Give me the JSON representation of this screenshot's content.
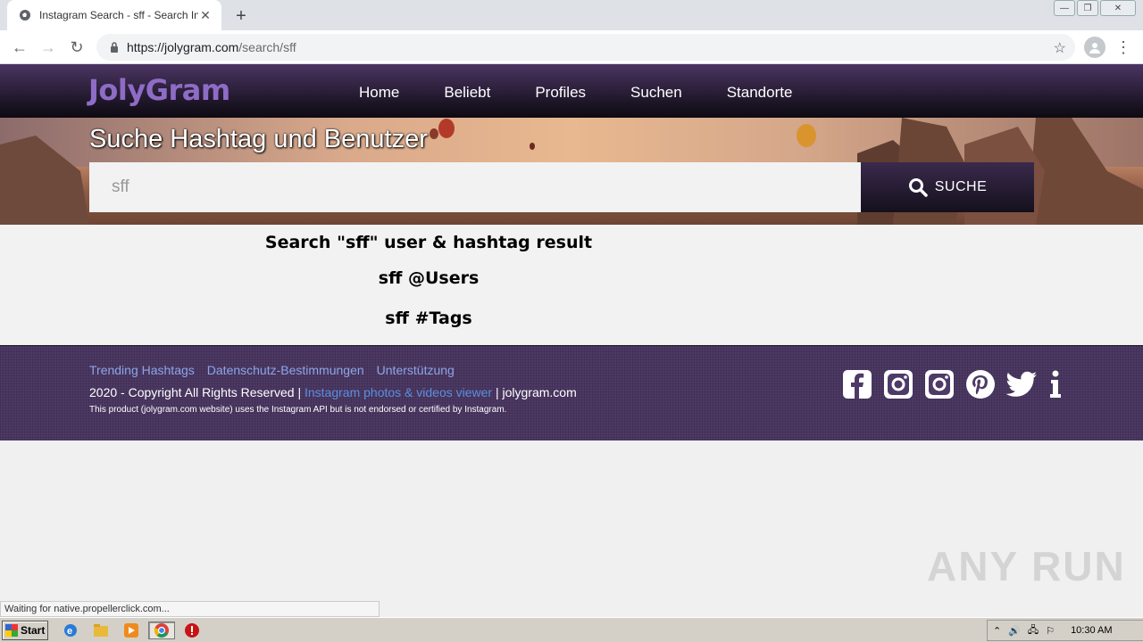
{
  "browser": {
    "tab_title": "Instagram Search - sff - Search In",
    "url_host": "https://jolygram.com",
    "url_path": "/search/sff"
  },
  "site": {
    "logo": "JolyGram",
    "nav": [
      "Home",
      "Beliebt",
      "Profiles",
      "Suchen",
      "Standorte"
    ]
  },
  "hero": {
    "title": "Suche Hashtag und Benutzer",
    "search_value": "sff",
    "search_button": "SUCHE"
  },
  "results": {
    "heading": "Search \"sff\" user & hashtag result",
    "users_heading": "sff @Users",
    "tags_heading": "sff #Tags"
  },
  "footer": {
    "links": [
      "Trending Hashtags",
      "Datenschutz-Bestimmungen",
      "Unterstützung"
    ],
    "copyright_prefix": "2020 - Copyright All Rights Reserved |",
    "copyright_link": "Instagram photos & videos viewer",
    "copyright_suffix": "| jolygram.com",
    "disclaimer": "This product (jolygram.com website) uses the Instagram API but is not endorsed or certified by Instagram.",
    "socials": [
      "facebook-icon",
      "instagram-icon",
      "instagram-icon",
      "pinterest-icon",
      "twitter-icon",
      "info-icon"
    ]
  },
  "status": {
    "text": "Waiting for native.propellerclick.com..."
  },
  "watermark": "ANY RUN",
  "taskbar": {
    "start": "Start",
    "clock": "10:30 AM"
  }
}
